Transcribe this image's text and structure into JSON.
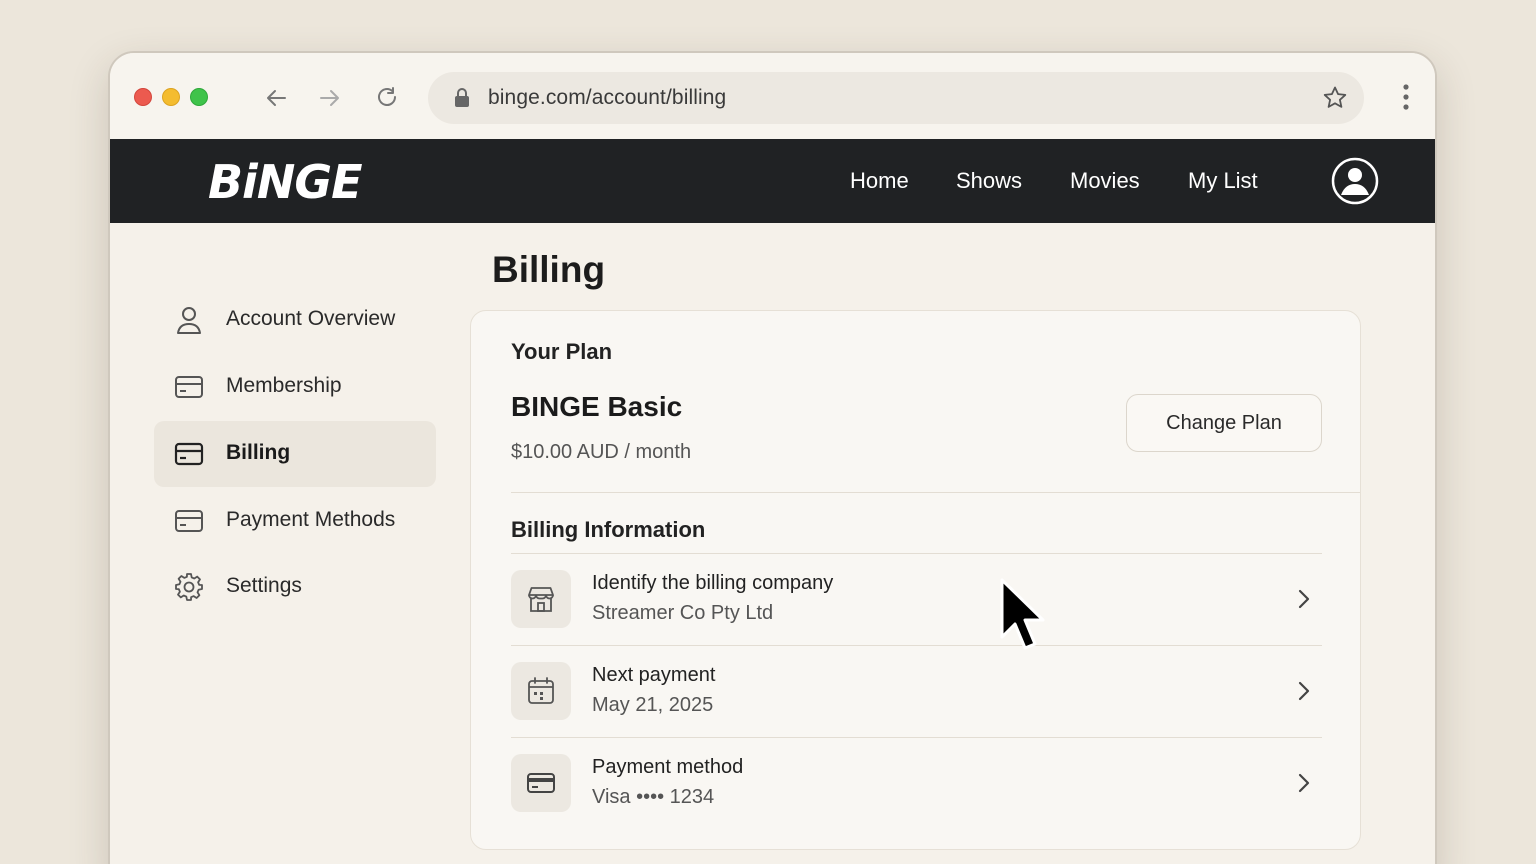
{
  "browser": {
    "url": "binge.com/account/billing"
  },
  "site": {
    "logo": "BiNGE",
    "nav": [
      "Home",
      "Shows",
      "Movies",
      "My List"
    ]
  },
  "sidebar": {
    "items": [
      {
        "label": "Account Overview",
        "icon": "person-icon"
      },
      {
        "label": "Membership",
        "icon": "card-icon"
      },
      {
        "label": "Billing",
        "icon": "card-icon",
        "active": true
      },
      {
        "label": "Payment Methods",
        "icon": "card-icon"
      },
      {
        "label": "Settings",
        "icon": "gear-icon"
      }
    ]
  },
  "page": {
    "title": "Billing"
  },
  "plan": {
    "heading": "Your Plan",
    "name": "BINGE Basic",
    "price": "$10.00 AUD / month",
    "change_label": "Change Plan"
  },
  "billing_info": {
    "heading": "Billing Information",
    "rows": [
      {
        "title": "Identify the billing company",
        "value": "Streamer Co Pty Ltd",
        "icon": "storefront-icon"
      },
      {
        "title": "Next payment",
        "value": "May 21, 2025",
        "icon": "calendar-icon"
      },
      {
        "title": "Payment method",
        "value": "Visa •••• 1234",
        "icon": "credit-card-icon"
      }
    ]
  },
  "colors": {
    "header_bg": "#202224",
    "page_bg": "#f5f1ea",
    "active_item_bg": "#ebe6dd"
  }
}
